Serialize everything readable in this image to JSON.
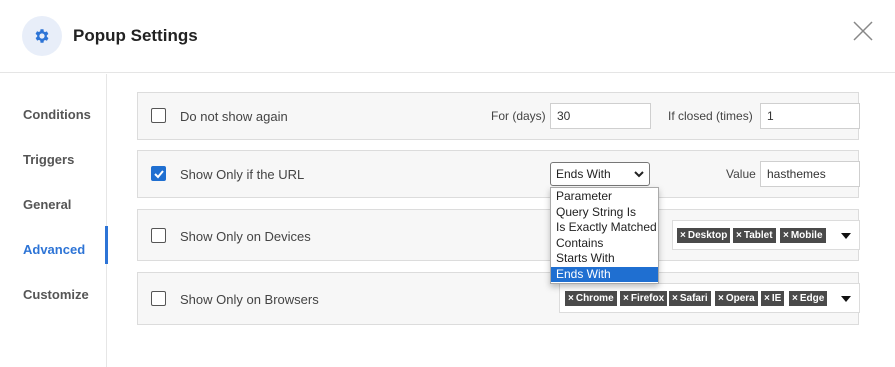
{
  "header": {
    "title": "Popup Settings",
    "icon": "gear-icon",
    "close_icon": "close-icon"
  },
  "sidebar": {
    "items": [
      {
        "label": "Conditions",
        "active": false
      },
      {
        "label": "Triggers",
        "active": false
      },
      {
        "label": "General",
        "active": false
      },
      {
        "label": "Advanced",
        "active": true
      },
      {
        "label": "Customize",
        "active": false
      }
    ]
  },
  "rows": {
    "do_not_show": {
      "checked": false,
      "label": "Do not show again",
      "for_days_label": "For (days)",
      "for_days_value": "30",
      "if_closed_label": "If closed (times)",
      "if_closed_value": "1"
    },
    "url": {
      "checked": true,
      "label": "Show Only if the URL",
      "match_selected": "Ends With",
      "match_options": [
        "Parameter",
        "Query String Is",
        "Is Exactly Matched",
        "Contains",
        "Starts With",
        "Ends With"
      ],
      "value_label": "Value",
      "value": "hasthemes"
    },
    "devices": {
      "checked": false,
      "label": "Show Only on Devices",
      "tags": [
        "Desktop",
        "Tablet",
        "Mobile"
      ]
    },
    "browsers": {
      "checked": false,
      "label": "Show Only on Browsers",
      "tags": [
        "Chrome",
        "Firefox",
        "Safari",
        "Opera",
        "IE",
        "Edge"
      ]
    }
  },
  "colors": {
    "accent": "#2d74d6",
    "tag_bg": "#4a4a4a",
    "row_bg": "#f7f7f7"
  }
}
